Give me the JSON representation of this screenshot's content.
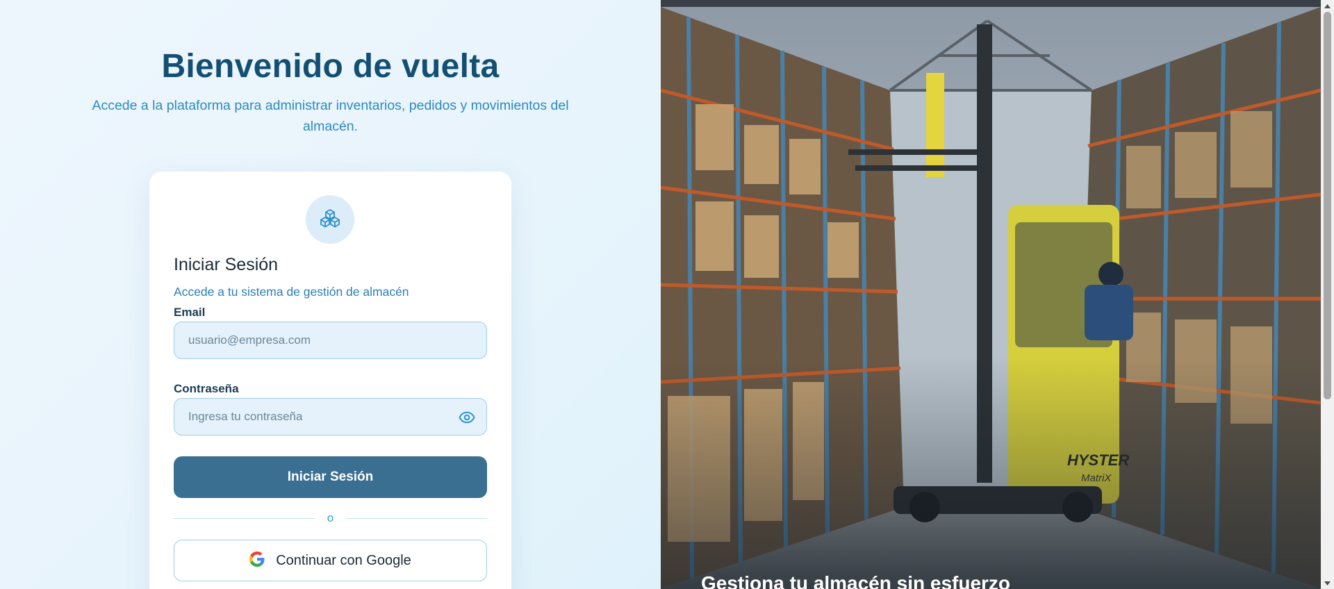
{
  "hero": {
    "title": "Bienvenido de vuelta",
    "subtitle": "Accede a la plataforma para administrar inventarios, pedidos y movimientos del almacén."
  },
  "login_card": {
    "logo_icon": "boxes-icon",
    "title": "Iniciar Sesión",
    "subtitle": "Accede a tu sistema de gestión de almacén",
    "email": {
      "label": "Email",
      "placeholder": "usuario@empresa.com",
      "value": ""
    },
    "password": {
      "label": "Contraseña",
      "placeholder": "Ingresa tu contraseña",
      "value": "",
      "toggle_icon": "eye-icon"
    },
    "submit_label": "Iniciar Sesión",
    "divider_text": "o",
    "google": {
      "icon": "google-icon",
      "label": "Continuar con Google"
    }
  },
  "side_panel": {
    "image_description_icon": "warehouse-forklift-photo",
    "caption": "Gestiona tu almacén sin esfuerzo"
  },
  "colors": {
    "primary": "#3b6f92",
    "heading": "#134f72",
    "accent_text": "#2c8bc0",
    "input_bg": "#e6f2fb",
    "input_border": "#9ccde6"
  }
}
